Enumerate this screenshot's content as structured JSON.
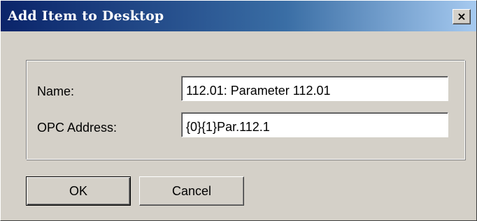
{
  "window": {
    "title": "Add Item to Desktop",
    "close_glyph": "×"
  },
  "form": {
    "name_label": "Name:",
    "name_value": "112.01: Parameter 112.01",
    "opc_label": "OPC Address:",
    "opc_value": "{0}{1}Par.112.1"
  },
  "buttons": {
    "ok_label": "OK",
    "cancel_label": "Cancel"
  },
  "colors": {
    "titlebar_start": "#0a246a",
    "titlebar_end": "#a6caf0",
    "face": "#d4d0c8"
  }
}
